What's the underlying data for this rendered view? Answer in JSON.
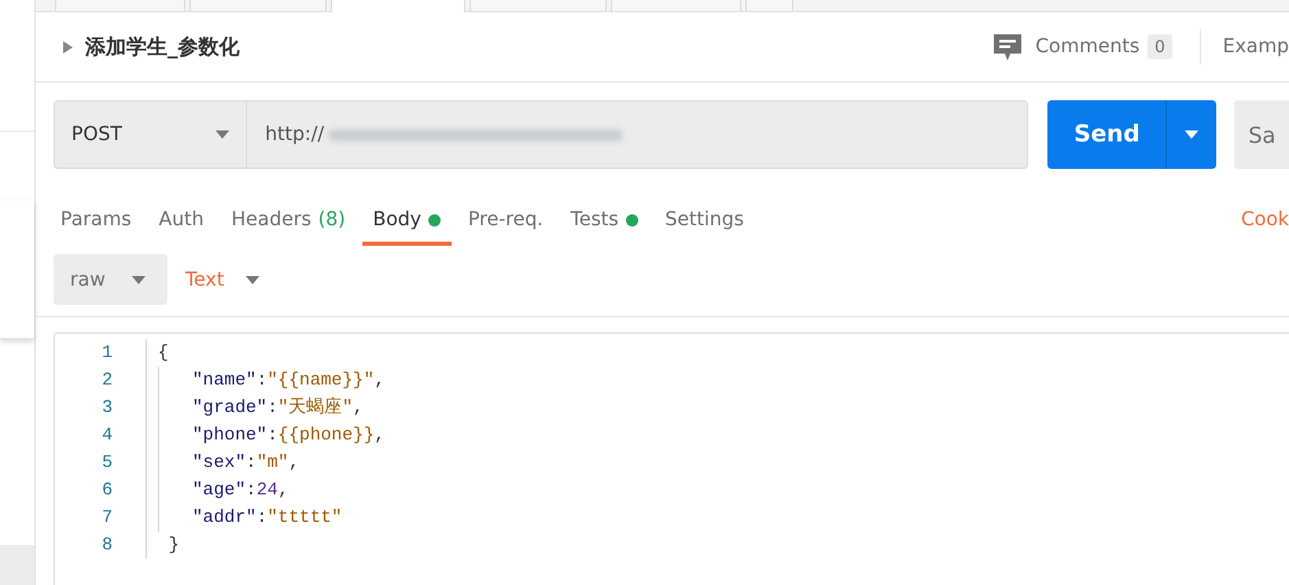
{
  "request_tabs": [
    {
      "selected": false
    },
    {
      "selected": false
    },
    {
      "selected": true
    },
    {
      "selected": false
    },
    {
      "selected": false
    },
    {
      "selected": false
    }
  ],
  "request": {
    "title": "添加学生_参数化",
    "comments_label": "Comments",
    "comments_count": "0",
    "examples_label": "Examp"
  },
  "url_bar": {
    "method": "POST",
    "url": "http://",
    "send": "Send",
    "save": "Sa"
  },
  "tabs": [
    {
      "label": "Params",
      "selected": false
    },
    {
      "label": "Auth",
      "selected": false
    },
    {
      "label": "Headers",
      "count": "(8)",
      "selected": false
    },
    {
      "label": "Body",
      "dot": true,
      "selected": true
    },
    {
      "label": "Pre-req.",
      "selected": false
    },
    {
      "label": "Tests",
      "dot": true,
      "selected": false
    },
    {
      "label": "Settings",
      "selected": false
    }
  ],
  "cookies_link": "Cook",
  "body_mode": {
    "mode": "raw",
    "format": "Text"
  },
  "editor": {
    "lines": [
      [
        {
          "kind": "punct",
          "text": "{"
        }
      ],
      [
        {
          "kind": "indent"
        },
        {
          "kind": "key",
          "text": "\"name\""
        },
        {
          "kind": "punct",
          "text": ":"
        },
        {
          "kind": "string",
          "text": "\"{{name}}\""
        },
        {
          "kind": "punct",
          "text": ","
        }
      ],
      [
        {
          "kind": "indent"
        },
        {
          "kind": "key",
          "text": "\"grade\""
        },
        {
          "kind": "punct",
          "text": ":"
        },
        {
          "kind": "string",
          "text": "\"天蝎座\""
        },
        {
          "kind": "punct",
          "text": ","
        }
      ],
      [
        {
          "kind": "indent"
        },
        {
          "kind": "key",
          "text": "\"phone\""
        },
        {
          "kind": "punct",
          "text": ":"
        },
        {
          "kind": "variable",
          "text": "{{phone}}"
        },
        {
          "kind": "punct",
          "text": ","
        }
      ],
      [
        {
          "kind": "indent"
        },
        {
          "kind": "key",
          "text": "\"sex\""
        },
        {
          "kind": "punct",
          "text": ":"
        },
        {
          "kind": "string",
          "text": "\"m\""
        },
        {
          "kind": "punct",
          "text": ","
        }
      ],
      [
        {
          "kind": "indent"
        },
        {
          "kind": "key",
          "text": "\"age\""
        },
        {
          "kind": "punct",
          "text": ":"
        },
        {
          "kind": "number",
          "text": "24"
        },
        {
          "kind": "punct",
          "text": ","
        }
      ],
      [
        {
          "kind": "indent"
        },
        {
          "kind": "key",
          "text": "\"addr\""
        },
        {
          "kind": "punct",
          "text": ":"
        },
        {
          "kind": "string",
          "text": "\"ttttt\""
        }
      ],
      [
        {
          "kind": "punct",
          "text": " }"
        }
      ]
    ],
    "line_numbers": [
      "1",
      "2",
      "3",
      "4",
      "5",
      "6",
      "7",
      "8"
    ]
  }
}
